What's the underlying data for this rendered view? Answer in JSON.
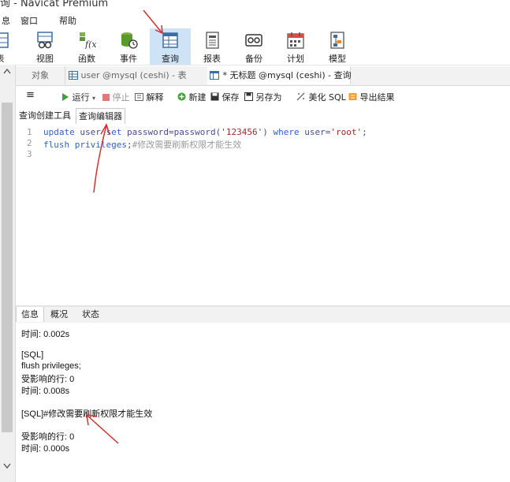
{
  "window": {
    "title": "询 - Navicat Premium"
  },
  "menu": [
    "息",
    "窗口",
    "帮助"
  ],
  "toolbar": {
    "items": [
      {
        "label": "表",
        "icon": "table-icon"
      },
      {
        "label": "视图",
        "icon": "view-icon"
      },
      {
        "label": "函数",
        "icon": "function-icon"
      },
      {
        "label": "事件",
        "icon": "event-icon"
      },
      {
        "label": "查询",
        "icon": "query-icon",
        "active": true
      },
      {
        "label": "报表",
        "icon": "report-icon"
      },
      {
        "label": "备份",
        "icon": "backup-icon"
      },
      {
        "label": "计划",
        "icon": "schedule-icon"
      },
      {
        "label": "模型",
        "icon": "model-icon"
      }
    ]
  },
  "tabs": [
    {
      "label": "对象"
    },
    {
      "label": "user @mysql (ceshi) - 表"
    },
    {
      "label": "* 无标题 @mysql (ceshi) - 查询",
      "active": true
    }
  ],
  "query_toolbar": {
    "menu": "≡",
    "run": "运行",
    "stop": "停止",
    "explain": "解释",
    "new": "新建",
    "save": "保存",
    "save_as": "另存为",
    "beautify": "美化 SQL",
    "export": "导出结果"
  },
  "sub_tabs": [
    {
      "label": "查询创建工具"
    },
    {
      "label": "查询编辑器",
      "active": true
    }
  ],
  "editor": {
    "line_numbers": [
      "1",
      "2",
      "3"
    ],
    "line1": {
      "kw_update": "update",
      "ident_user": "user",
      "kw_set": "set",
      "assign": "password=password(",
      "str_value": "'123456'",
      "close_paren": ")",
      "kw_where": "where",
      "cond": "user=",
      "str_root": "'root'",
      "semi": ";"
    },
    "line2": {
      "kw_flush": "flush",
      "ident_priv": "privileges",
      "semi": ";",
      "comment": "#修改需要刷新权限才能生效"
    }
  },
  "result_tabs": [
    {
      "label": "信息",
      "active": true
    },
    {
      "label": "概况"
    },
    {
      "label": "状态"
    }
  ],
  "info": {
    "lines": [
      "时间: 0.002s",
      "",
      "[SQL]",
      "flush privileges;",
      "受影响的行: 0",
      "时间: 0.008s",
      "",
      "[SQL]#修改需要刷新权限才能生效",
      "",
      "受影响的行: 0",
      "时间: 0.000s"
    ]
  },
  "colors": {
    "active_toolbar": "#cfe3f6",
    "keyword": "#2e5fd6",
    "string": "#b0282e",
    "comment": "#9a9a9a",
    "annotation_arrow": "#d7302c"
  }
}
